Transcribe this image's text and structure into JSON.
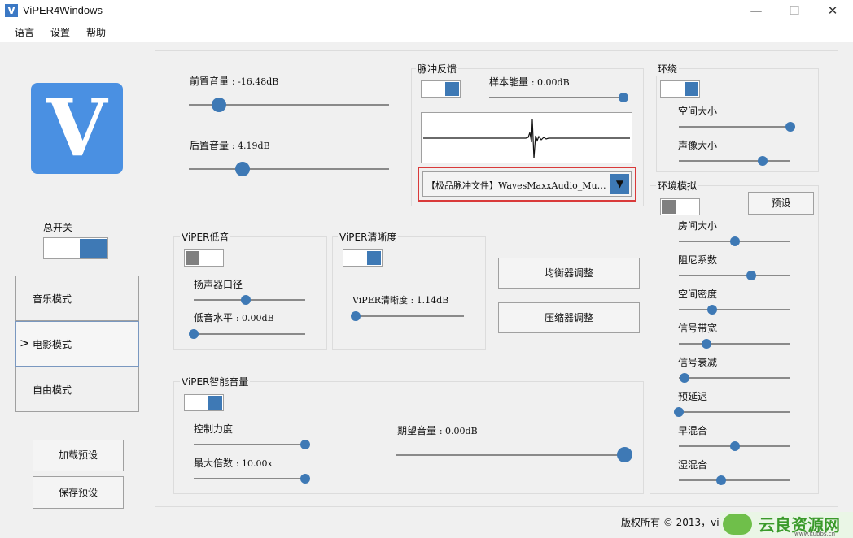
{
  "window": {
    "title": "ViPER4Windows",
    "icon_letter": "V",
    "minimize": "—",
    "maximize": "☐",
    "close": "✕"
  },
  "menu": [
    "语言",
    "设置",
    "帮助"
  ],
  "logo": {
    "letter": "V"
  },
  "master_switch": {
    "label": "总开关",
    "on": true
  },
  "modes": [
    {
      "label": "音乐模式",
      "active": false
    },
    {
      "label": "电影模式",
      "active": true
    },
    {
      "label": "自由模式",
      "active": false
    }
  ],
  "mode_arrow": ">",
  "buttons": {
    "load_preset": "加载预设",
    "save_preset": "保存预设",
    "equalizer": "均衡器调整",
    "compressor": "压缩器调整",
    "env_preset": "预设"
  },
  "volume": {
    "pre_label": "前置音量",
    "pre_value": "-16.48dB",
    "pre_level": 0.15,
    "post_label": "后置音量",
    "post_value": "4.19dB",
    "post_level": 0.27
  },
  "convolver": {
    "title": "脉冲反馈",
    "on": true,
    "energy_label": "样本能量",
    "energy_value": "0.00dB",
    "energy_level": 1.0,
    "file": "【极品脉冲文件】WavesMaxxAudio_Mu…",
    "dropdown_icon": "▼"
  },
  "surround": {
    "title": "环绕",
    "on": true,
    "space_label": "空间大小",
    "space_level": 1.0,
    "image_label": "声像大小",
    "image_level": 0.75
  },
  "env": {
    "title": "环境模拟",
    "on": false,
    "params": [
      {
        "label": "房间大小",
        "level": 0.5
      },
      {
        "label": "阻尼系数",
        "level": 0.65
      },
      {
        "label": "空间密度",
        "level": 0.3
      },
      {
        "label": "信号带宽",
        "level": 0.25
      },
      {
        "label": "信号衰减",
        "level": 0.05
      },
      {
        "label": "预延迟",
        "level": 0.0
      },
      {
        "label": "早混合",
        "level": 0.5
      },
      {
        "label": "湿混合",
        "level": 0.38
      }
    ]
  },
  "bass": {
    "title": "ViPER低音",
    "on": false,
    "speaker_label": "扬声器口径",
    "speaker_level": 0.47,
    "level_label": "低音水平",
    "level_value": "0.00dB",
    "bass_level": 0.0
  },
  "clarity": {
    "title": "ViPER清晰度",
    "on": true,
    "value_label": "ViPER清晰度",
    "value": "1.14dB",
    "level": 0.03
  },
  "agc": {
    "title": "ViPER智能音量",
    "on": true,
    "strength_label": "控制力度",
    "strength_level": 1.0,
    "max_label": "最大倍数",
    "max_value": "10.00x",
    "max_level": 1.0,
    "target_label": "期望音量",
    "target_value": "0.00dB",
    "target_level": 1.0
  },
  "footer": {
    "copyright": "版权所有 © 2013，vip"
  },
  "watermark": {
    "text": "云良资源网",
    "url": "www.kubbs.cn"
  },
  "colors": {
    "accent": "#3e79b5",
    "logo": "#4a90e2",
    "highlight_border": "#d93a3a"
  }
}
